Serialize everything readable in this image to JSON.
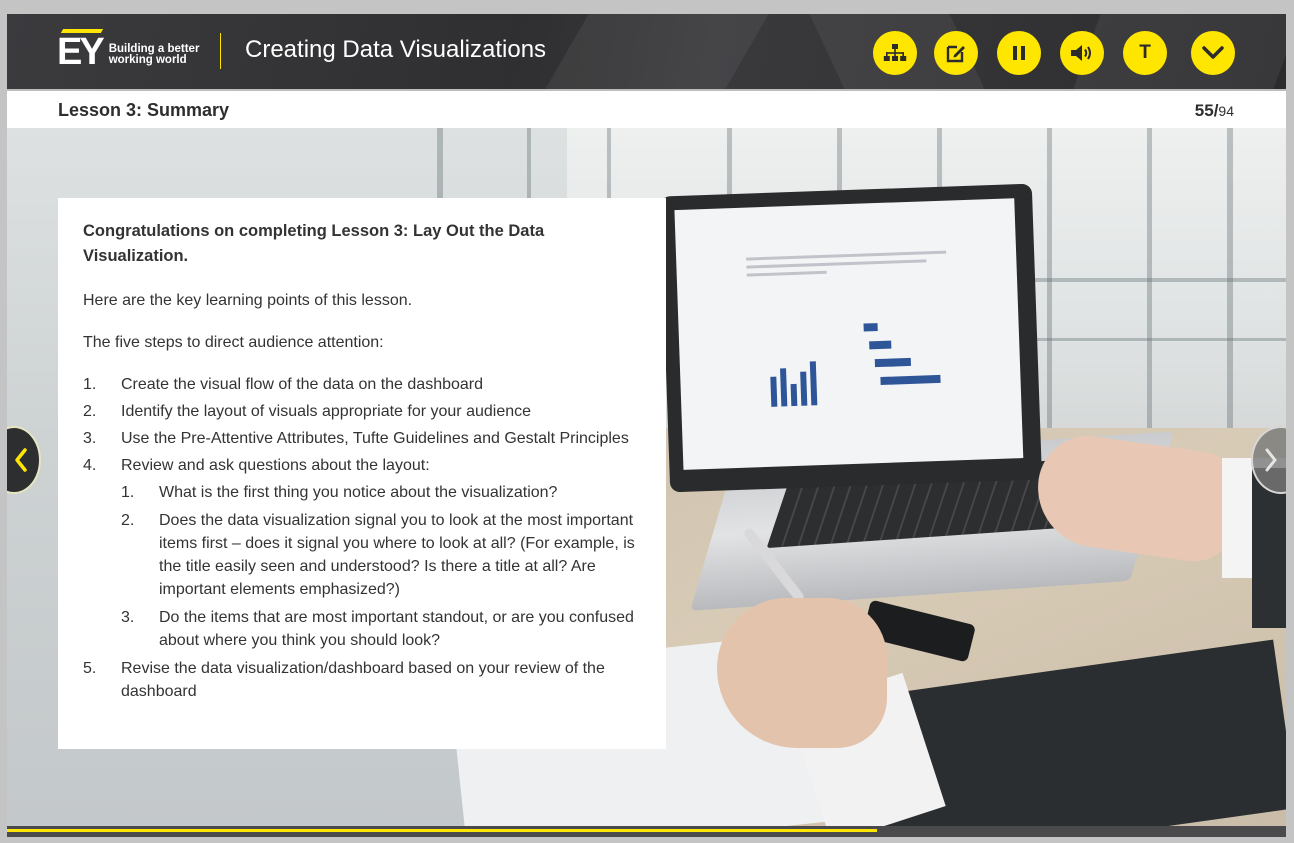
{
  "header": {
    "logo_text": "EY",
    "tagline_line1": "Building a better",
    "tagline_line2": "working world",
    "course_title": "Creating Data Visualizations",
    "accent_color": "#ffe600",
    "toolbar": [
      {
        "name": "menu-structure-button",
        "icon": "sitemap-icon"
      },
      {
        "name": "notes-button",
        "icon": "edit-note-icon"
      },
      {
        "name": "pause-button",
        "icon": "pause-icon"
      },
      {
        "name": "audio-button",
        "icon": "speaker-icon"
      },
      {
        "name": "transcript-button",
        "icon": "t-letter-icon",
        "label": "T"
      },
      {
        "name": "more-button",
        "icon": "chevron-down-icon"
      }
    ]
  },
  "subheader": {
    "lesson_title": "Lesson 3: Summary",
    "page_current": "55/",
    "page_total": "94"
  },
  "content": {
    "intro": "Congratulations on completing Lesson 3: Lay Out the Data Visualization.",
    "lead": "Here are the key learning points of this lesson.",
    "steps_heading": "The five steps to direct audience attention:",
    "steps": [
      {
        "num": "1.",
        "text": "Create the visual flow of the data on the dashboard"
      },
      {
        "num": "2.",
        "text": "Identify the layout of visuals appropriate for your audience"
      },
      {
        "num": "3.",
        "text": "Use the Pre-Attentive Attributes, Tufte Guidelines and Gestalt Principles"
      },
      {
        "num": "4.",
        "text": "Review and ask questions about the layout:"
      },
      {
        "num": "5.",
        "text": "Revise the data visualization/dashboard based on your review of the dashboard"
      }
    ],
    "substeps": [
      {
        "num": "1.",
        "text": "What is the first thing you notice about the visualization?"
      },
      {
        "num": "2.",
        "text": "Does the data visualization signal you to look at the most important items first – does it signal you where to look at all? (For example, is the title easily seen and understood? Is there a title at all? Are important elements emphasized?)"
      },
      {
        "num": "3.",
        "text": "Do the items that are most important standout, or are you confused about where you think you should look?"
      }
    ]
  },
  "navigation": {
    "prev_icon": "chevron-left-icon",
    "next_icon": "chevron-right-icon"
  },
  "progress": {
    "fraction": 0.68
  }
}
